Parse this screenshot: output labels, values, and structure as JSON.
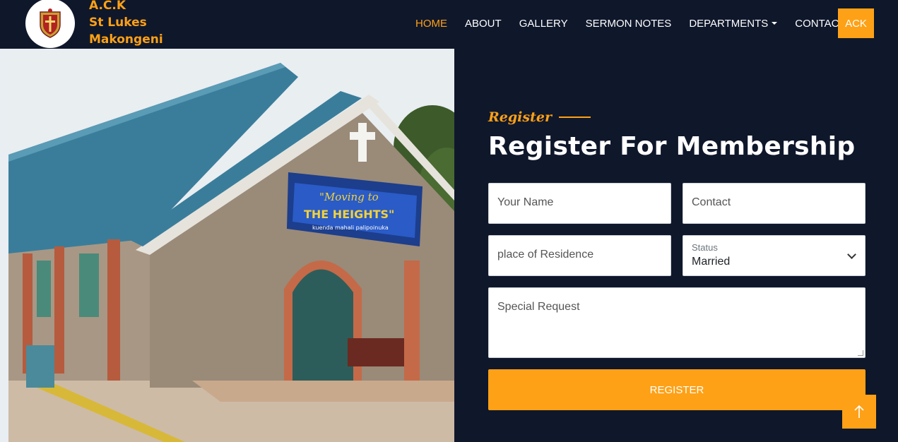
{
  "brand": {
    "line1": "A.C.K",
    "line2": "St Lukes",
    "line3": "Makongeni"
  },
  "nav": {
    "home": "HOME",
    "about": "ABOUT",
    "gallery": "GALLERY",
    "sermon_notes": "SERMON NOTES",
    "departments": "DEPARTMENTS",
    "contact": "CONTACT",
    "ack_button": "ACK"
  },
  "form": {
    "eyebrow": "Register",
    "title": "Register For Membership",
    "name_placeholder": "Your Name",
    "contact_placeholder": "Contact",
    "residence_placeholder": "place of Residence",
    "status_label": "Status",
    "status_value": "Married",
    "request_placeholder": "Special Request",
    "submit_label": "REGISTER"
  },
  "banner": {
    "line1": "\"Moving to",
    "line2": "THE HEIGHTS\"",
    "line3": "kuenda mahali palipoinuka"
  },
  "colors": {
    "accent": "#fea116",
    "dark_bg": "#0f172b"
  },
  "icons": {
    "logo": "church-crest-icon",
    "back_to_top": "arrow-up-icon",
    "dropdown": "chevron-down-icon"
  }
}
